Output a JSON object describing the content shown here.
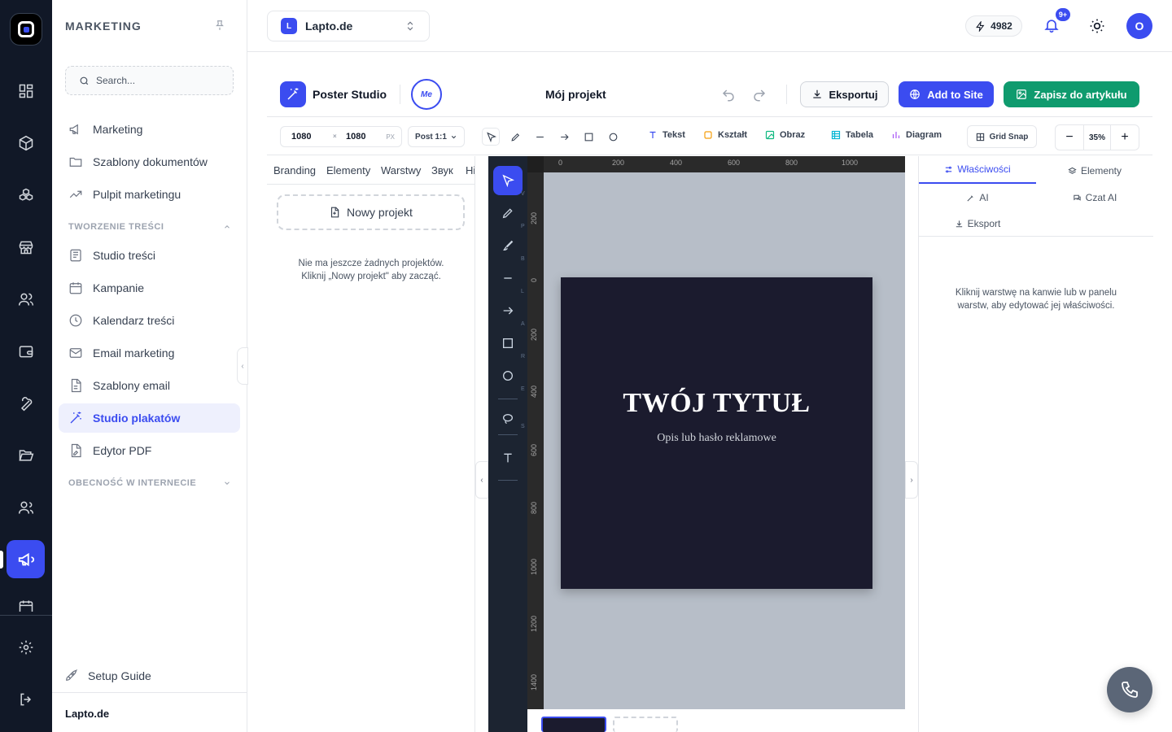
{
  "sidebar": {
    "title": "MARKETING",
    "search_placeholder": "Search...",
    "items": [
      {
        "label": "Marketing"
      },
      {
        "label": "Szablony dokumentów"
      },
      {
        "label": "Pulpit marketingu"
      },
      {
        "label": "Studio treści"
      },
      {
        "label": "Kampanie"
      },
      {
        "label": "Kalendarz treści"
      },
      {
        "label": "Email marketing"
      },
      {
        "label": "Szablony email"
      },
      {
        "label": "Studio plakatów"
      },
      {
        "label": "Edytor PDF"
      }
    ],
    "sections": {
      "content_creation": "TWORZENIE TREŚCI",
      "online_presence": "OBECNOŚĆ W INTERNECIE"
    },
    "setup_guide": "Setup Guide",
    "footer": "Lapto.de"
  },
  "topbar": {
    "site_badge": "L",
    "site_name": "Lapto.de",
    "credits": "4982",
    "notifications_badge": "9+",
    "avatar_initial": "O"
  },
  "studio": {
    "name": "Poster Studio",
    "me_badge": "Me",
    "project_title": "Mój projekt",
    "export_label": "Eksportuj",
    "add_to_site_label": "Add to Site",
    "save_to_article_label": "Zapisz do artykułu"
  },
  "toolbar": {
    "width": "1080",
    "height": "1080",
    "times": "×",
    "unit": "PX",
    "preset": "Post 1:1",
    "text_label": "Tekst",
    "shape_label": "Kształt",
    "image_label": "Obraz",
    "table_label": "Tabela",
    "diagram_label": "Diagram",
    "grid_snap_label": "Grid Snap",
    "zoom_out": "−",
    "zoom_value": "35%",
    "zoom_in": "+"
  },
  "left_panel": {
    "tabs": [
      "Branding",
      "Elementy",
      "Warstwy",
      "Звук",
      "Hi"
    ],
    "new_project": "Nowy projekt",
    "empty_line1": "Nie ma jeszcze żadnych projektów.",
    "empty_line2": "Kliknij „Nowy projekt\" aby zacząć."
  },
  "canvas": {
    "tool_keys": [
      "V",
      "P",
      "B",
      "L",
      "A",
      "R",
      "E",
      "S"
    ],
    "ruler_h": [
      "0",
      "200",
      "400",
      "600",
      "800",
      "1000"
    ],
    "ruler_v": [
      "200",
      "0",
      "200",
      "400",
      "600",
      "800",
      "1000",
      "1200",
      "1400"
    ],
    "poster_title": "TWÓJ TYTUŁ",
    "poster_subtitle": "Opis lub hasło reklamowe",
    "poster_bg": "#1b1b2e"
  },
  "right_panel": {
    "tab_properties": "Właściwości",
    "tab_elements": "Elementy",
    "tab_ai": "AI",
    "tab_ai_chat": "Czat AI",
    "tab_export": "Eksport",
    "empty_line1": "Kliknij warstwę na kanwie lub w panelu",
    "empty_line2": "warstw, aby edytować jej właściwości."
  },
  "colors": {
    "accent": "#3b4cf0",
    "save_green": "#0f9b6e",
    "rail": "#111827"
  }
}
